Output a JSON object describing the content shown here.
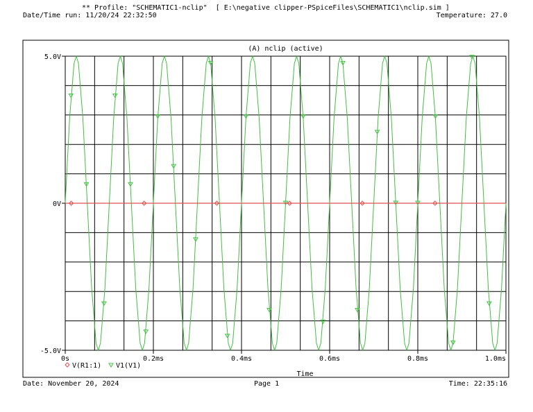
{
  "header": {
    "profile_line": "** Profile: \"SCHEMATIC1-nclip\"  [ E:\\negative clipper-PSpiceFiles\\SCHEMATIC1\\nclip.sim ]",
    "run_line": "Date/Time run: 11/20/24 22:32:50",
    "temperature_line": "Temperature: 27.0"
  },
  "footer": {
    "date_line": "Date: November 20, 2024",
    "page_line": "Page 1",
    "time_line": "Time: 22:35:16"
  },
  "chart_data": {
    "type": "line",
    "title": "(A) nclip (active)",
    "xlabel": "Time",
    "ylabel": "",
    "xlim": [
      0,
      1.0
    ],
    "ylim": [
      -5.0,
      5.0
    ],
    "x_unit": "ms",
    "x_tick_labels": [
      "0s",
      "0.2ms",
      "0.4ms",
      "0.6ms",
      "0.8ms",
      "1.0ms"
    ],
    "x_ticks": [
      0,
      0.2,
      0.4,
      0.6,
      0.8,
      1.0
    ],
    "y_tick_labels": [
      "5.0V",
      "0V",
      "-5.0V"
    ],
    "y_ticks": [
      5.0,
      0,
      -5.0
    ],
    "grid": true,
    "x_grid_divisions": 15,
    "y_grid_divisions": 10,
    "legend_position": "bottom-left",
    "series": [
      {
        "name": "V(R1:1)",
        "color": "#e05050",
        "marker": "diamond",
        "x": [
          0.0,
          1.0
        ],
        "y": [
          0.0,
          0.0
        ],
        "marker_x": [
          0.0136,
          0.179,
          0.344,
          0.509,
          0.674,
          0.839
        ]
      },
      {
        "name": "V1(V1)",
        "color": "#40c040",
        "marker": "triangle-down",
        "amplitude": 5.0,
        "frequency_khz": 10,
        "x": [
          0.0,
          0.01,
          0.02,
          0.025,
          0.03,
          0.04,
          0.05,
          0.06,
          0.07,
          0.075,
          0.08,
          0.09,
          0.1
        ],
        "y": [
          0.0,
          2.9,
          4.76,
          5.0,
          4.76,
          2.9,
          0.0,
          -2.9,
          -4.76,
          -5.0,
          -4.76,
          -2.9,
          0.0
        ],
        "periodic_until": 1.0,
        "marker_x": [
          0.013,
          0.048,
          0.088,
          0.113,
          0.148,
          0.183,
          0.21,
          0.246,
          0.296,
          0.33,
          0.368,
          0.41,
          0.463,
          0.5,
          0.54,
          0.585,
          0.63,
          0.663,
          0.708,
          0.75,
          0.8,
          0.84,
          0.88,
          0.923,
          0.962
        ]
      }
    ]
  }
}
